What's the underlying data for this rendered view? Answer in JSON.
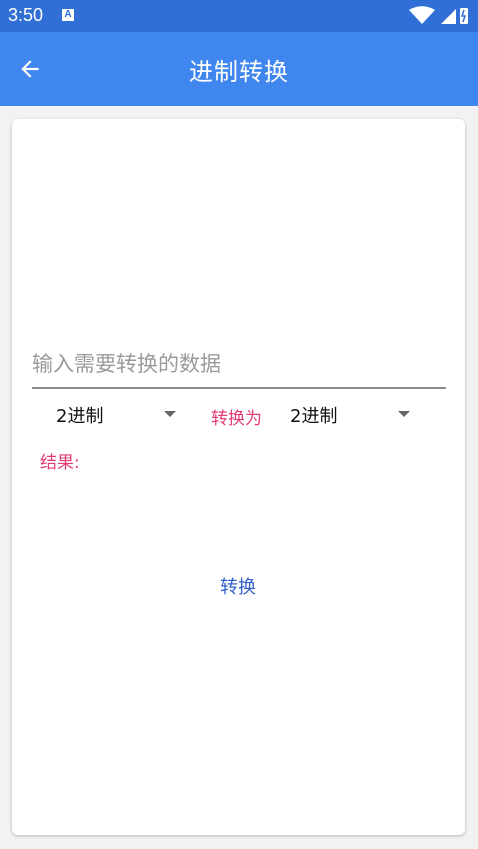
{
  "status_bar": {
    "time": "3:50",
    "notification_badge": "A",
    "icons": [
      "wifi-icon",
      "signal-icon",
      "battery-icon"
    ]
  },
  "app_bar": {
    "title": "进制转换",
    "back_icon": "arrow-back-icon"
  },
  "converter": {
    "input_placeholder": "输入需要转换的数据",
    "input_value": "",
    "from_base": "2进制",
    "convert_to_label": "转换为",
    "to_base": "2进制",
    "result_label": "结果:",
    "result_value": "",
    "convert_button": "转换"
  },
  "colors": {
    "status_bar": "#2f6fd6",
    "app_bar": "#3f86ee",
    "accent_pink": "#e33c74",
    "button_blue": "#2f5fcb"
  }
}
